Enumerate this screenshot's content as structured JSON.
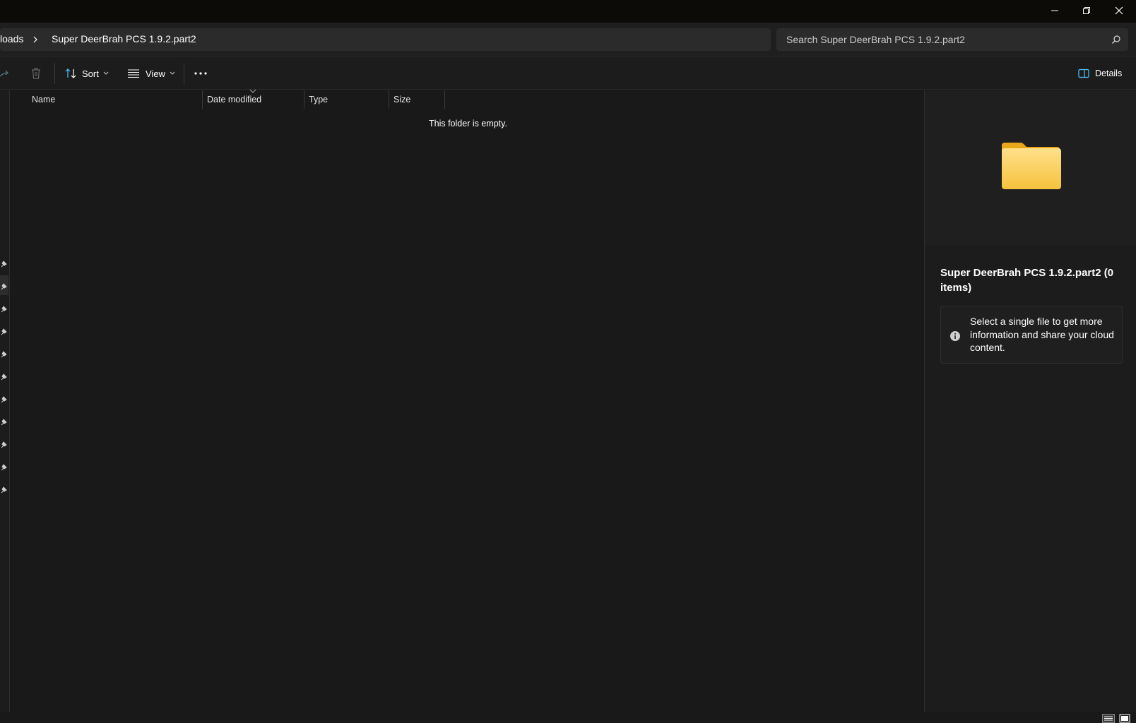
{
  "window": {
    "minimize_icon": "minimize-icon",
    "restore_icon": "restore-icon",
    "close_icon": "close-icon"
  },
  "address": {
    "prev_crumb": "loads",
    "current_crumb": "Super DeerBrah PCS 1.9.2.part2",
    "search_placeholder": "Search Super DeerBrah PCS 1.9.2.part2"
  },
  "toolbar": {
    "sort_label": "Sort",
    "view_label": "View",
    "more_label": "...",
    "details_label": "Details"
  },
  "columns": {
    "name": "Name",
    "date_modified": "Date modified",
    "type": "Type",
    "size": "Size"
  },
  "main": {
    "empty_message": "This folder is empty."
  },
  "details_pane": {
    "title": "Super DeerBrah PCS 1.9.2.part2 (0 items)",
    "info_message": "Select a single file to get more information and share your cloud content.",
    "folder_icon": "folder-icon",
    "info_icon": "info-icon"
  },
  "colors": {
    "background": "#191919",
    "titlebar": "#0d0b07",
    "field": "#2b2b2b",
    "folder_yellow": "#f7c948",
    "accent_blue": "#4cc2ff"
  }
}
